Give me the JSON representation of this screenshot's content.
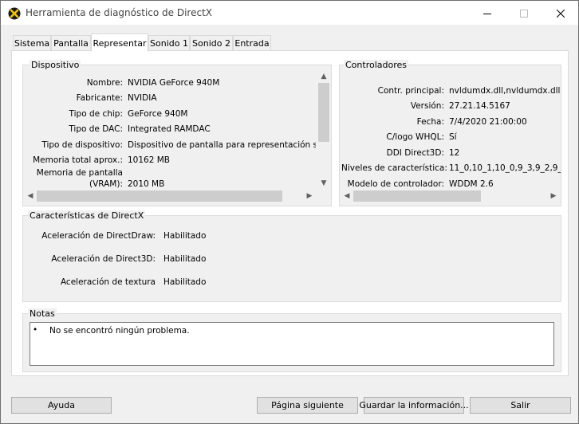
{
  "window": {
    "title": "Herramienta de diagnóstico de DirectX"
  },
  "tabs": [
    {
      "label": "Sistema"
    },
    {
      "label": "Pantalla"
    },
    {
      "label": "Representar"
    },
    {
      "label": "Sonido 1"
    },
    {
      "label": "Sonido 2"
    },
    {
      "label": "Entrada"
    }
  ],
  "device": {
    "title": "Dispositivo",
    "rows": [
      {
        "label": "Nombre:",
        "value": "NVIDIA GeForce 940M"
      },
      {
        "label": "Fabricante:",
        "value": "NVIDIA"
      },
      {
        "label": "Tipo de chip:",
        "value": "GeForce 940M"
      },
      {
        "label": "Tipo de DAC:",
        "value": "Integrated RAMDAC"
      },
      {
        "label": "Tipo de dispositivo:",
        "value": "Dispositivo de pantalla para representación solam"
      },
      {
        "label": "Memoria total aprox.:",
        "value": "10162 MB"
      },
      {
        "label_line1": "Memoria de pantalla",
        "label_line2": "(VRAM):",
        "value": "2010 MB"
      }
    ]
  },
  "drivers": {
    "title": "Controladores",
    "rows": [
      {
        "label": "Contr. principal:",
        "value": "nvldumdx.dll,nvldumdx.dll,nv"
      },
      {
        "label": "Versión:",
        "value": "27.21.14.5167"
      },
      {
        "label": "Fecha:",
        "value": "7/4/2020 21:00:00"
      },
      {
        "label": "C/logo WHQL:",
        "value": "Sí"
      },
      {
        "label": "DDI Direct3D:",
        "value": "12"
      },
      {
        "label": "Niveles de característica:",
        "value": "11_0,10_1,10_0,9_3,9_2,9_"
      },
      {
        "label": "Modelo de controlador:",
        "value": "WDDM 2.6"
      }
    ]
  },
  "features": {
    "title": "Características de DirectX",
    "rows": [
      {
        "label": "Aceleración de DirectDraw:",
        "value": "Habilitado"
      },
      {
        "label": "Aceleración de Direct3D:",
        "value": "Habilitado"
      },
      {
        "label": "Aceleración de textura",
        "value": "Habilitado"
      }
    ]
  },
  "notes": {
    "title": "Notas",
    "bullet": "•",
    "items": [
      "No se encontró ningún problema."
    ]
  },
  "buttons": {
    "help": "Ayuda",
    "next_page": "Página siguiente",
    "save_info": "Guardar la información...",
    "exit": "Salir"
  },
  "colors": {
    "titlebar": "#ffffff",
    "dialog_bg": "#f0f0f0",
    "panel_bg": "#ffffff",
    "button_bg": "#e1e1e1",
    "scroll_thumb": "#cdcdcd"
  }
}
